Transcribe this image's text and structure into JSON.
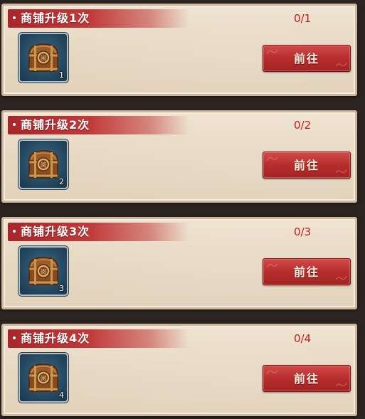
{
  "tasks": [
    {
      "title": "商铺升级1次",
      "progress": "0/1",
      "reward_qty": "1",
      "button_label": "前往"
    },
    {
      "title": "商铺升级2次",
      "progress": "0/2",
      "reward_qty": "2",
      "button_label": "前往"
    },
    {
      "title": "商铺升级3次",
      "progress": "0/3",
      "reward_qty": "3",
      "button_label": "前往"
    },
    {
      "title": "商铺升级4次",
      "progress": "0/4",
      "reward_qty": "4",
      "button_label": "前往"
    }
  ],
  "reward_icon": "treasure-chest-icon",
  "colors": {
    "ribbon": "#c13a3a",
    "progress": "#c21d1d",
    "button": "#b72d2d",
    "card_bg": "#e7d9c4",
    "slot_bg": "#264a62"
  }
}
